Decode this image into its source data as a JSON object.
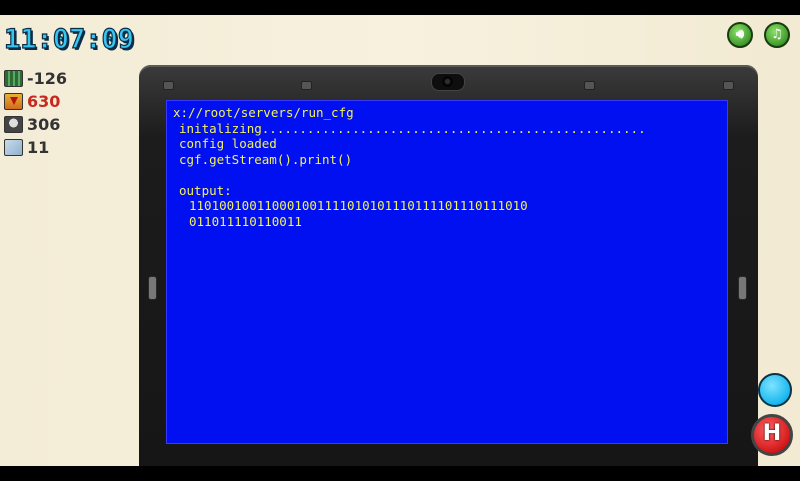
{
  "hud": {
    "clock": "11:07:09",
    "stats": [
      {
        "icon": "cpu-icon",
        "value": "-126"
      },
      {
        "icon": "download-icon",
        "value": "630"
      },
      {
        "icon": "hacker-helmet-icon",
        "value": "306"
      },
      {
        "icon": "map-icon",
        "value": "11"
      }
    ],
    "sound_icon": "speaker-icon",
    "music_icon": "music-note-icon"
  },
  "terminal": {
    "lines": [
      "x://root/servers/run_cfg",
      "initalizing...................................................",
      "config loaded",
      "cgf.getStream().print()",
      "",
      "output:",
      "110100100110001001111010101110111101110111010",
      "011011110110011"
    ]
  },
  "colors": {
    "screen_bg": "#0010f0",
    "terminal_text": "#f3f35a",
    "clock": "#38c6f0",
    "negative_stat": "#c8291f"
  },
  "buttons": {
    "action_icon": "cyan-circle-icon",
    "hack_icon": "red-h-icon",
    "hack_label": "H"
  }
}
